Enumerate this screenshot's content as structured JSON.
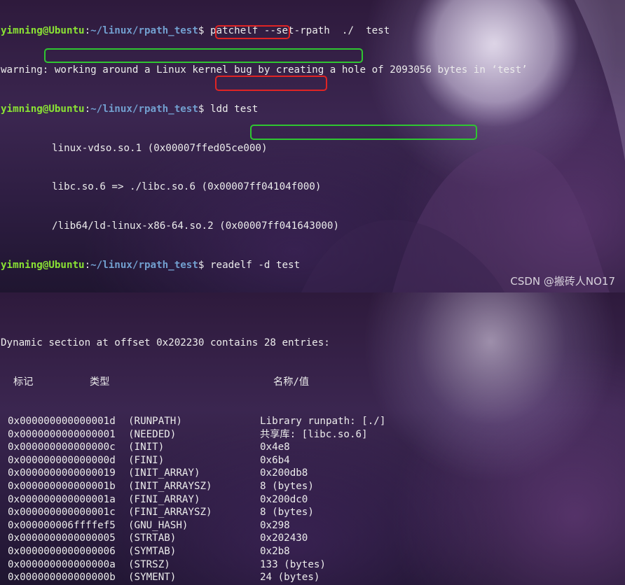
{
  "prompt": {
    "user": "yimning@Ubuntu",
    "path": "~/linux/rpath_test",
    "symbol": "$"
  },
  "lines": {
    "cmd1": "patchelf --set-rpath  ./  test",
    "warning": "warning: working around a Linux kernel bug by creating a hole of 2093056 bytes in ‘test’",
    "cmd2": "ldd test",
    "ldd_vdso": "linux-vdso.so.1 (0x00007ffed05ce000)",
    "ldd_libc": "libc.so.6 => ./libc.so.6 (0x00007ff04104f000)",
    "ldd_ld": "/lib64/ld-linux-x86-64.so.2 (0x00007ff041643000)",
    "cmd3": "readelf -d test",
    "dyn_header": "Dynamic section at offset 0x202230 contains 28 entries:",
    "col_tag": "标记",
    "col_type": "类型",
    "col_value": "名称/值"
  },
  "dynamic_entries": [
    {
      "tag": "0x000000000000001d",
      "type": "(RUNPATH)",
      "value": "Library runpath: [./]"
    },
    {
      "tag": "0x0000000000000001",
      "type": "(NEEDED)",
      "value": "共享库: [libc.so.6]"
    },
    {
      "tag": "0x000000000000000c",
      "type": "(INIT)",
      "value": "0x4e8"
    },
    {
      "tag": "0x000000000000000d",
      "type": "(FINI)",
      "value": "0x6b4"
    },
    {
      "tag": "0x0000000000000019",
      "type": "(INIT_ARRAY)",
      "value": "0x200db8"
    },
    {
      "tag": "0x000000000000001b",
      "type": "(INIT_ARRAYSZ)",
      "value": "8 (bytes)"
    },
    {
      "tag": "0x000000000000001a",
      "type": "(FINI_ARRAY)",
      "value": "0x200dc0"
    },
    {
      "tag": "0x000000000000001c",
      "type": "(FINI_ARRAYSZ)",
      "value": "8 (bytes)"
    },
    {
      "tag": "0x000000006ffffef5",
      "type": "(GNU_HASH)",
      "value": "0x298"
    },
    {
      "tag": "0x0000000000000005",
      "type": "(STRTAB)",
      "value": "0x202430"
    },
    {
      "tag": "0x0000000000000006",
      "type": "(SYMTAB)",
      "value": "0x2b8"
    },
    {
      "tag": "0x000000000000000a",
      "type": "(STRSZ)",
      "value": "133 (bytes)"
    },
    {
      "tag": "0x000000000000000b",
      "type": "(SYMENT)",
      "value": "24 (bytes)"
    }
  ],
  "watermark": "CSDN @搬砖人NO17",
  "colors": {
    "prompt_user": "#8ae234",
    "prompt_path": "#729fcf",
    "red_box": "#e02424",
    "green_box": "#2fc631"
  }
}
